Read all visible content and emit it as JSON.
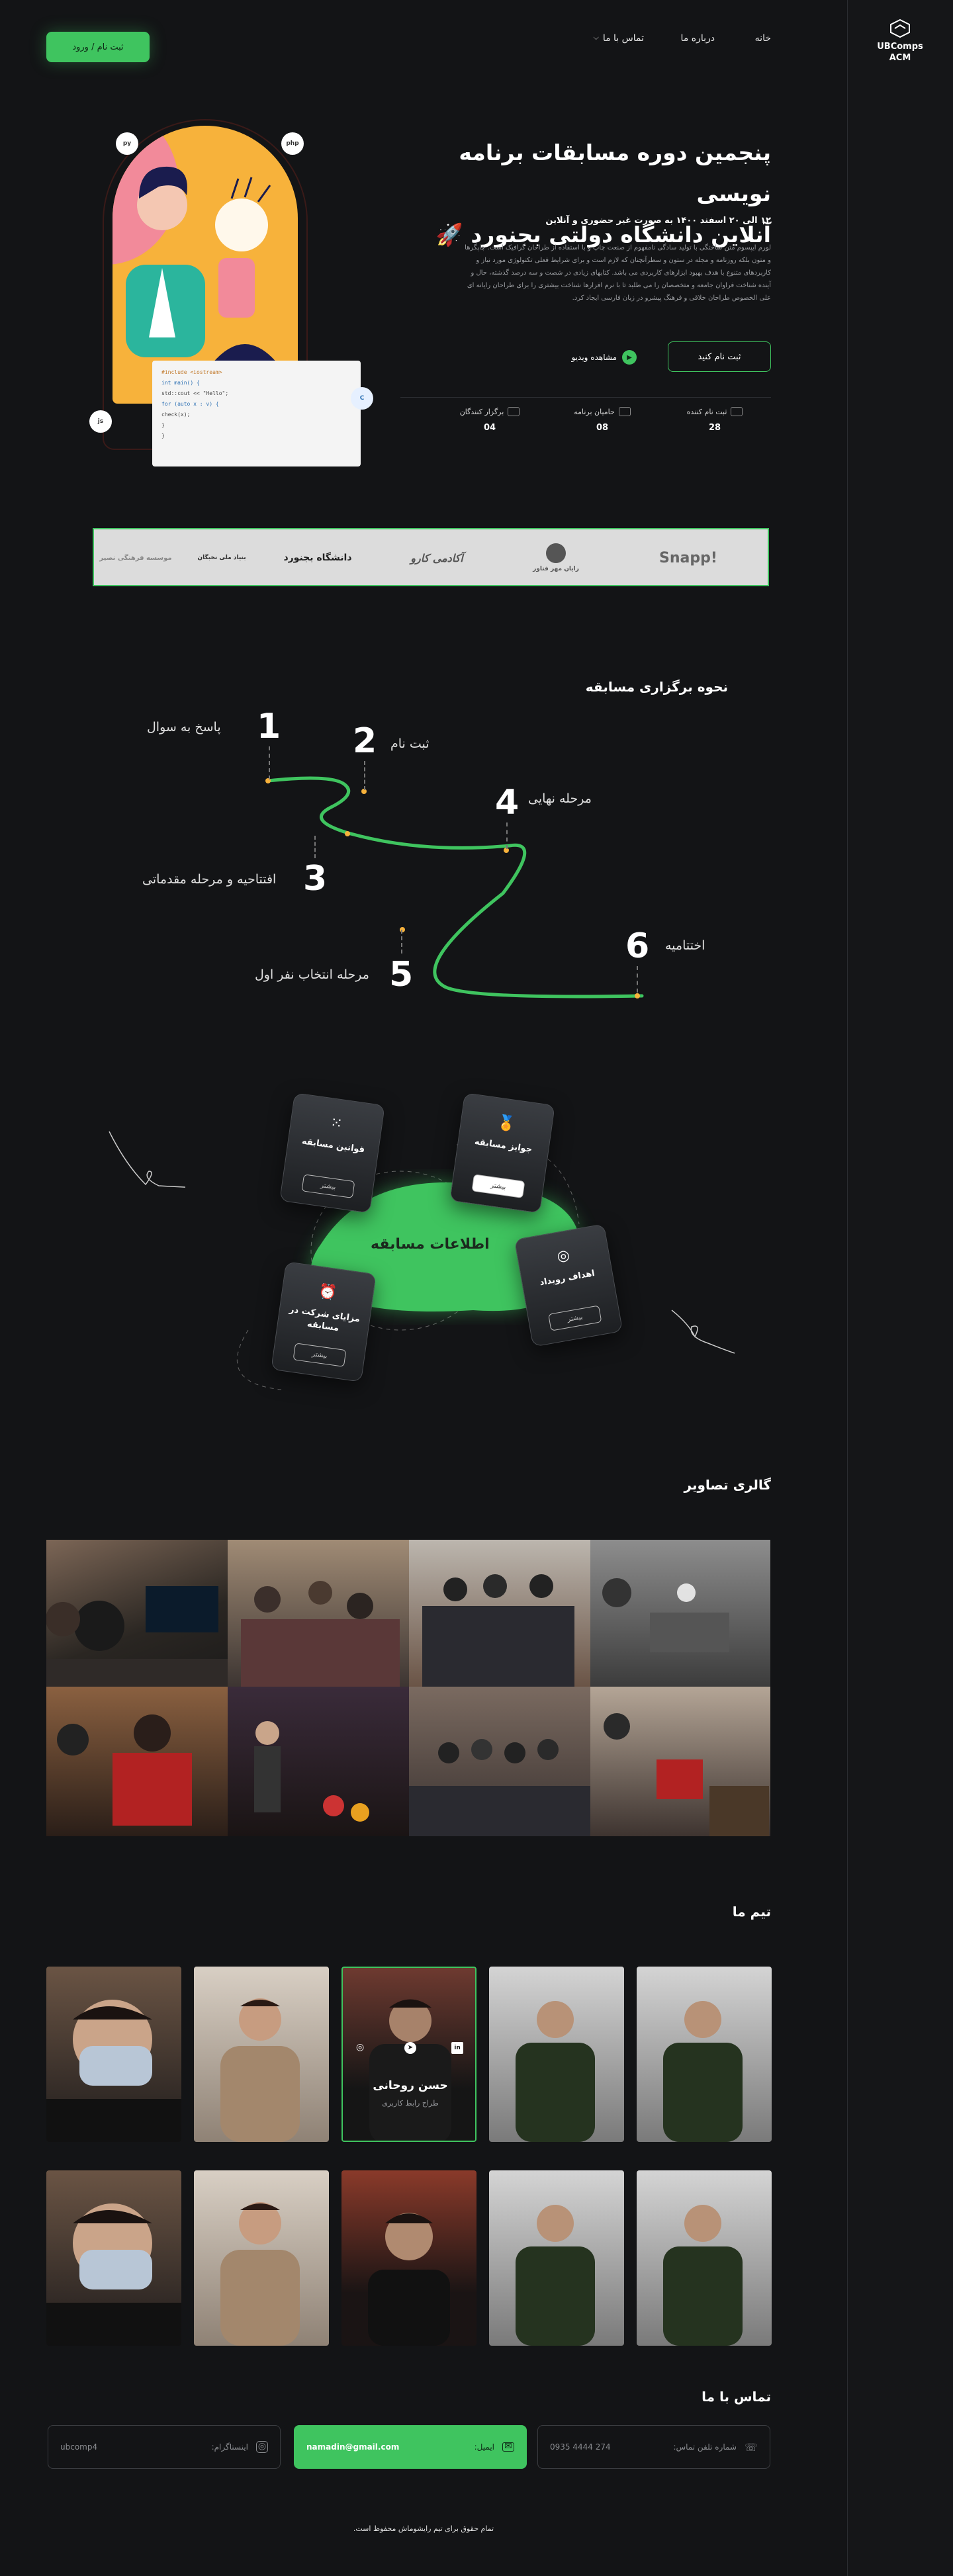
{
  "brand": {
    "line1": "UBComps",
    "line2": "ACM",
    "accent": "#3fc45f"
  },
  "nav": {
    "home": "خانه",
    "about": "درباره ما",
    "contact": "تماس با ما",
    "register_login": "ثبت نام / ورود"
  },
  "hero": {
    "title_line1": "پنجمین دوره مسابقات برنامه نویسی",
    "title_line2": "آنلاین دانشگاه دولتی بجنورد 🚀",
    "date": "۱۲ الی ۲۰ اسفند ۱۴۰۰ به صورت غیر حضوری و آنلاین",
    "description": "لورم ایپسوم متن ساختگی با تولید سادگی نامفهوم از صنعت چاپ و با استفاده از طراحان گرافیک است. چاپگرها و متون بلکه روزنامه و مجله در ستون و سطرآنچنان که لازم است و برای شرایط فعلی تکنولوژی مورد نیاز و کاربردهای متنوع با هدف بهبود ابزارهای کاربردی می باشد. کتابهای زیادی در شصت و سه درصد گذشته، حال و آینده شناخت فراوان جامعه و متخصصان را می طلبد تا با نرم افزارها شناخت بیشتری را برای طراحان رایانه ای علی الخصوص طراحان خلاقی و فرهنگ پیشرو در زبان فارسی ایجاد کرد.",
    "register_button": "ثبت نام کنید",
    "video_button": "مشاهده ویدیو",
    "stats": [
      {
        "label": "ثبت نام کننده",
        "value": "28"
      },
      {
        "label": "حامیان برنامه",
        "value": "08"
      },
      {
        "label": "برگزار کنندگان",
        "value": "04"
      }
    ]
  },
  "illustration": {
    "code_lines": [
      "#include <iostream>",
      "int main() {",
      "    std::cout << \"Hello\";",
      "    for (auto x : v) {",
      "        check(x);",
      "    }",
      "}",
      ""
    ],
    "badges": [
      "py",
      "php",
      "C",
      "js"
    ]
  },
  "sponsors": [
    "Snapp!",
    "رایان مهر فناور",
    "آکادمی کارو",
    "دانشگاه بجنورد",
    "بنیاد ملی نخبگان",
    "موسسه فرهنگی نصیر"
  ],
  "process": {
    "title": "نحوه برگزاری مسابقه",
    "steps": [
      {
        "num": "1",
        "label": "پاسخ به سوال"
      },
      {
        "num": "2",
        "label": "ثبت نام"
      },
      {
        "num": "3",
        "label": "افتتاحیه و مرحله مقدماتی"
      },
      {
        "num": "4",
        "label": "مرحله نهایی"
      },
      {
        "num": "5",
        "label": "مرحله انتخاب نفر اول"
      },
      {
        "num": "6",
        "label": "اختتامیه"
      }
    ]
  },
  "info": {
    "center_title": "اطلاعات مسابقه",
    "more": "بیشتر",
    "cards": [
      {
        "title": "قوانین مسابقه",
        "icon": "dots-grid-icon"
      },
      {
        "title": "جوایز مسابقه",
        "icon": "medal-icon"
      },
      {
        "title": "اهداف رویداد",
        "icon": "target-icon"
      },
      {
        "title": "مزایای شرکت در مسابقه",
        "icon": "alarm-icon"
      }
    ]
  },
  "gallery": {
    "title": "گالری تصاویر"
  },
  "team": {
    "title": "تیم ما",
    "featured": {
      "name": "حسن روحانی",
      "role": "طراح رابط کاربری"
    }
  },
  "contact": {
    "title": "تماس با ما",
    "phone": {
      "label": "شماره تلفن تماس:",
      "value": "0935 4444 274"
    },
    "email": {
      "label": "ایمیل:",
      "value": "namadin@gmail.com"
    },
    "instagram": {
      "label": "اینستاگرام:",
      "value": "ubcomp4"
    }
  },
  "footer": {
    "copyright": "تمام حقوق برای تیم رایشوماش محفوظ است."
  }
}
